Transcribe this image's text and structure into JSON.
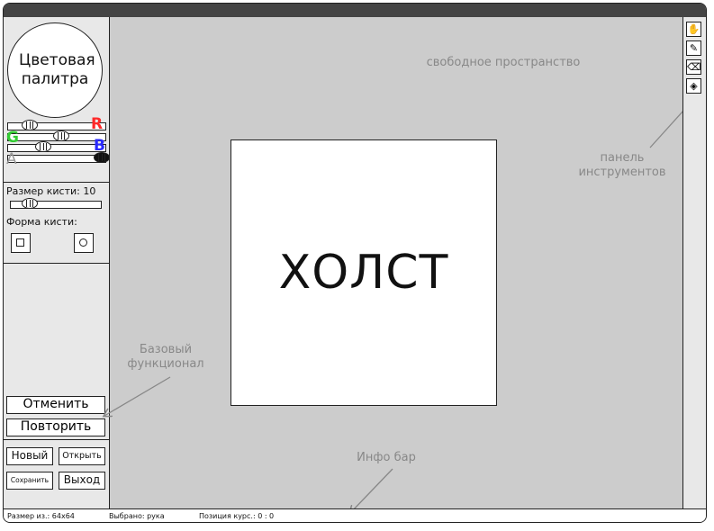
{
  "palette": {
    "label": "Цветовая палитра"
  },
  "channels": [
    {
      "letter": "R",
      "color": "#ff2a2a"
    },
    {
      "letter": "G",
      "color": "#33cc33"
    },
    {
      "letter": "B",
      "color": "#2a2aff"
    },
    {
      "letter": "A",
      "color": "#999999"
    }
  ],
  "brush": {
    "size_label": "Размер кисти:",
    "size_value": "10",
    "shape_label": "Форма кисти:"
  },
  "buttons": {
    "undo": "Отменить",
    "redo": "Повторить",
    "new": "Новый",
    "open": "Открыть",
    "save": "Сохранить",
    "exit": "Выход"
  },
  "canvas": {
    "label": "ХОЛСТ"
  },
  "annotations": {
    "free_space": "свободное пространство",
    "toolbar": "панель инструментов",
    "base": "Базовый функционал",
    "info": "Инфо бар"
  },
  "tools": [
    {
      "icon": "hand-icon",
      "glyph": "✋"
    },
    {
      "icon": "pencil-icon",
      "glyph": "✎"
    },
    {
      "icon": "eraser-icon",
      "glyph": "⌫"
    },
    {
      "icon": "fill-bucket-icon",
      "glyph": "◈"
    }
  ],
  "info_bar": {
    "size": "Размер из.: 64х64",
    "selected": "Выбрано: рука",
    "position": "Позиция курс.: 0 : 0"
  }
}
